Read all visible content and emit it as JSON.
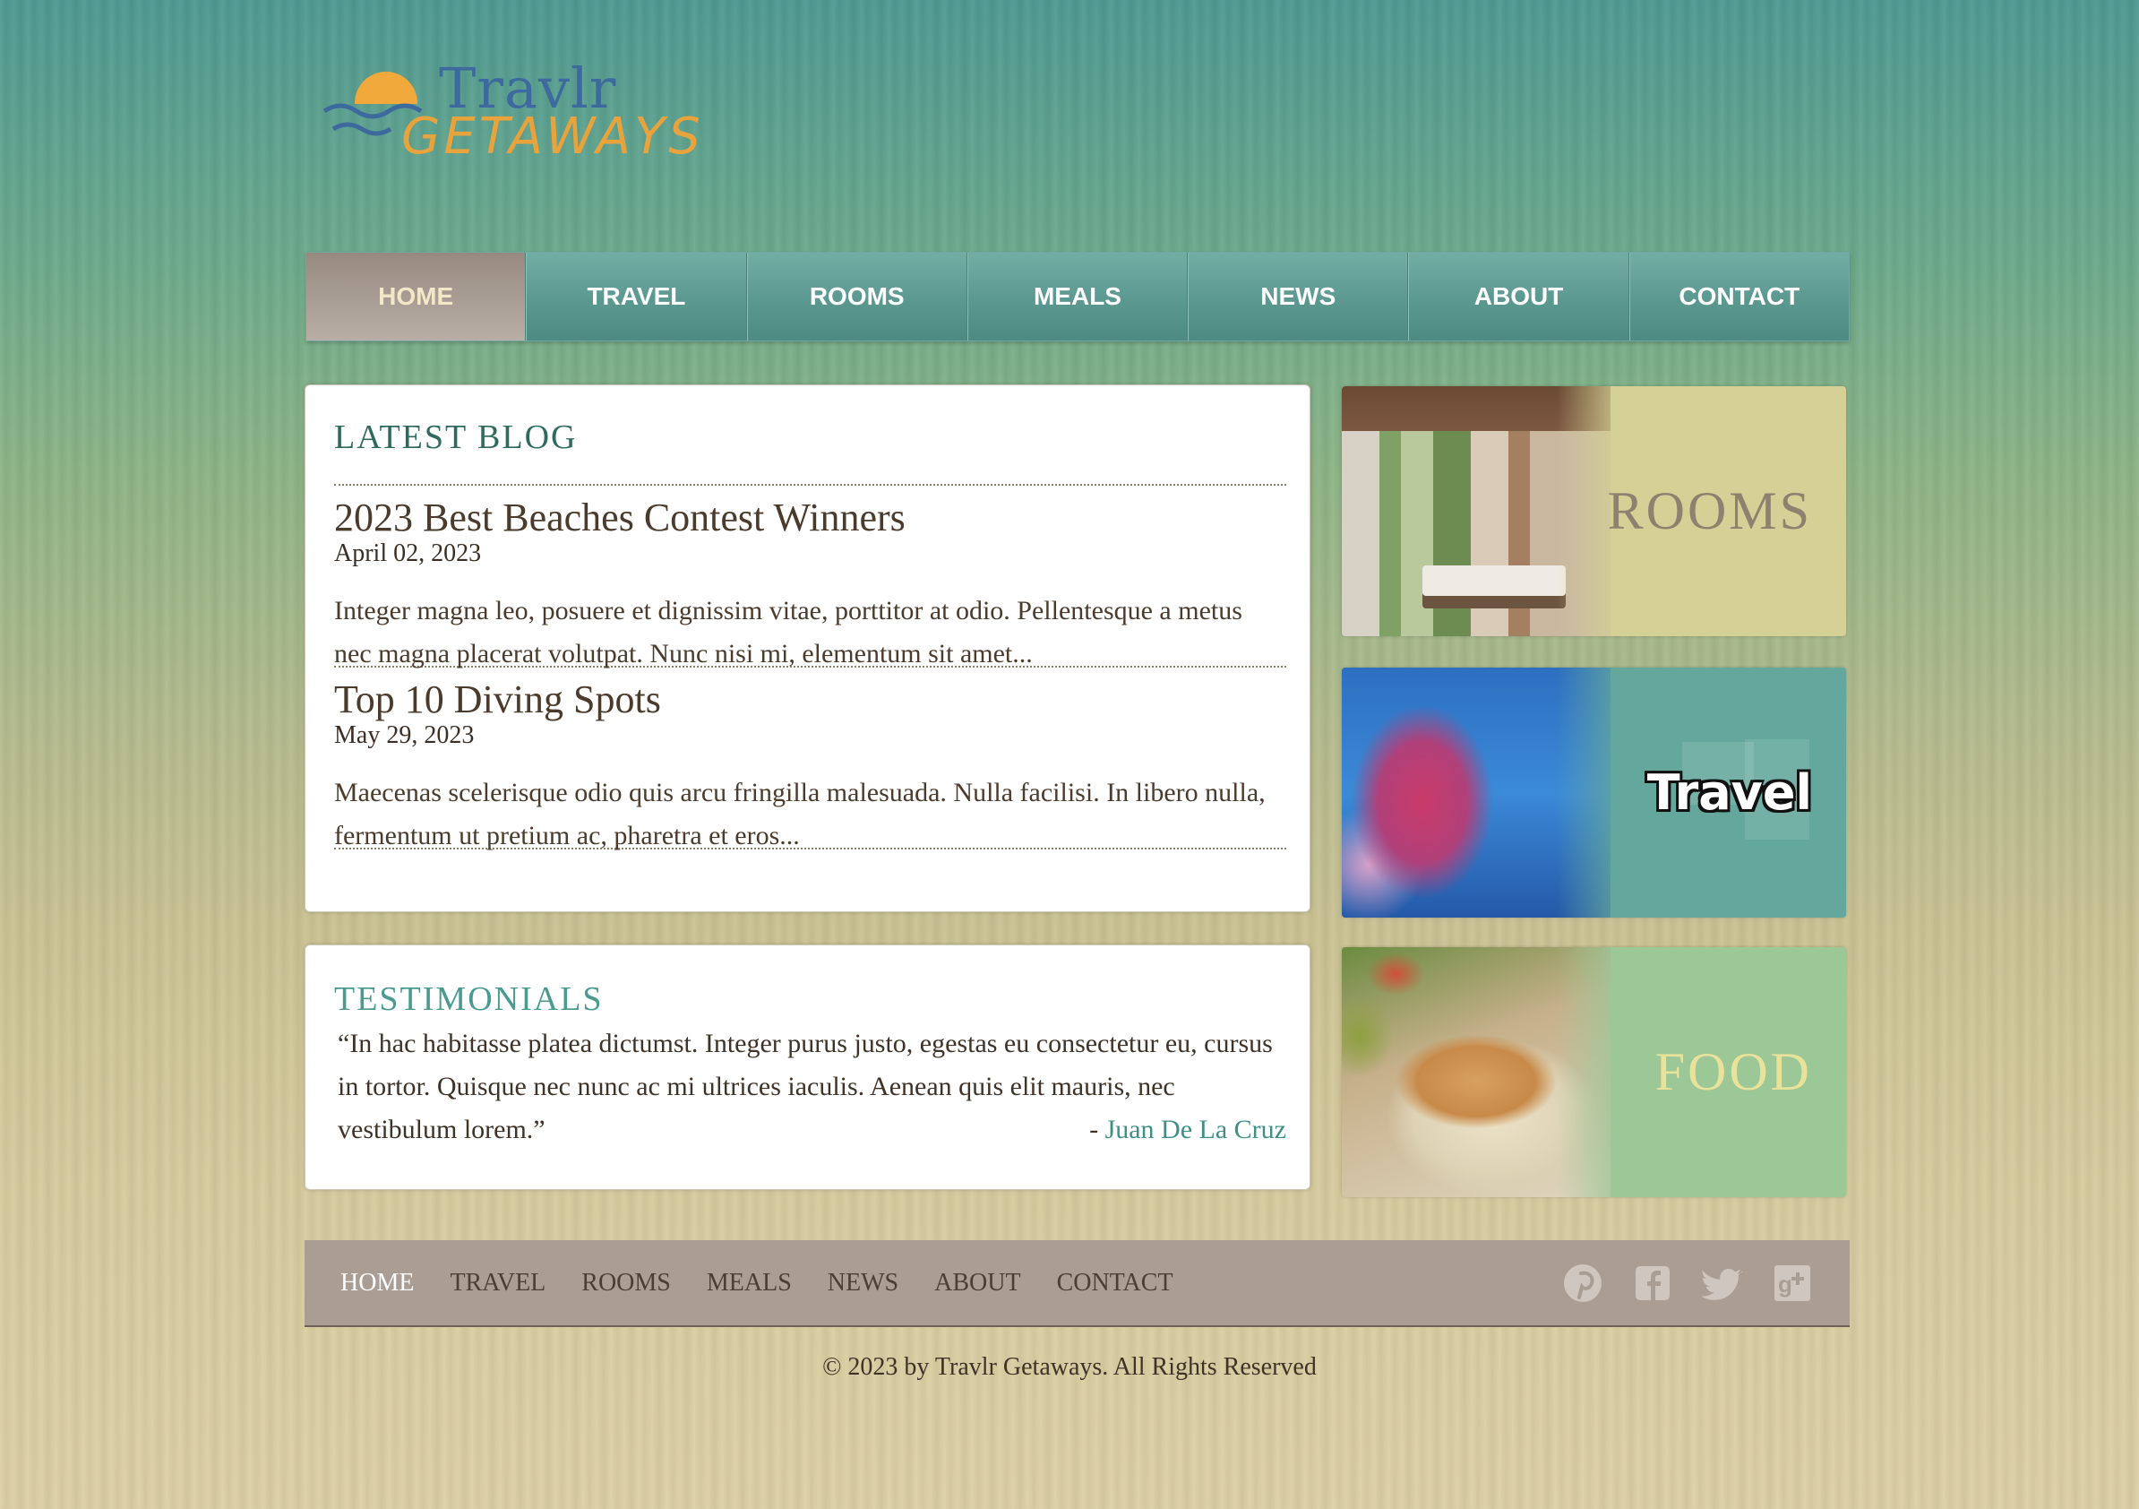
{
  "logo": {
    "line1": "Travlr",
    "line2": "Getaways"
  },
  "nav": {
    "items": [
      {
        "label": "HOME",
        "active": true
      },
      {
        "label": "TRAVEL"
      },
      {
        "label": "ROOMS"
      },
      {
        "label": "MEALS"
      },
      {
        "label": "NEWS"
      },
      {
        "label": "ABOUT"
      },
      {
        "label": "CONTACT"
      }
    ]
  },
  "blog": {
    "heading": "LATEST BLOG",
    "posts": [
      {
        "title": "2023 Best Beaches Contest Winners",
        "date": "April 02, 2023",
        "excerpt": "Integer magna leo, posuere et dignissim vitae, porttitor at odio. Pellentesque a metus nec magna placerat volutpat. Nunc nisi mi, elementum sit amet..."
      },
      {
        "title": "Top 10 Diving Spots",
        "date": "May 29, 2023",
        "excerpt": "Maecenas scelerisque odio quis arcu fringilla malesuada. Nulla facilisi. In libero nulla, fermentum ut pretium ac, pharetra et eros..."
      }
    ]
  },
  "testimonials": {
    "heading": "TESTIMONIALS",
    "quote": "“In hac habitasse platea dictumst. Integer purus justo, egestas eu consectetur eu, cursus in tortor. Quisque nec nunc ac mi ultrices iaculis. Aenean quis elit mauris, nec vestibulum lorem.”",
    "author_prefix": "- ",
    "author": "Juan De La Cruz"
  },
  "tiles": {
    "rooms": "ROOMS",
    "travel": "Travel",
    "food": "FOOD"
  },
  "footer": {
    "items": [
      "HOME",
      "TRAVEL",
      "ROOMS",
      "MEALS",
      "NEWS",
      "ABOUT",
      "CONTACT"
    ],
    "social_icons": [
      "pinterest-icon",
      "facebook-icon",
      "twitter-icon",
      "google-plus-icon"
    ],
    "copyright": "© 2023 by Travlr Getaways. All Rights Reserved"
  },
  "colors": {
    "nav_teal": "#5b9890",
    "nav_active": "#aba098",
    "heading_teal": "#2f6a5f",
    "link_teal": "#3e8f85",
    "footer_bg": "#aa9d94"
  }
}
